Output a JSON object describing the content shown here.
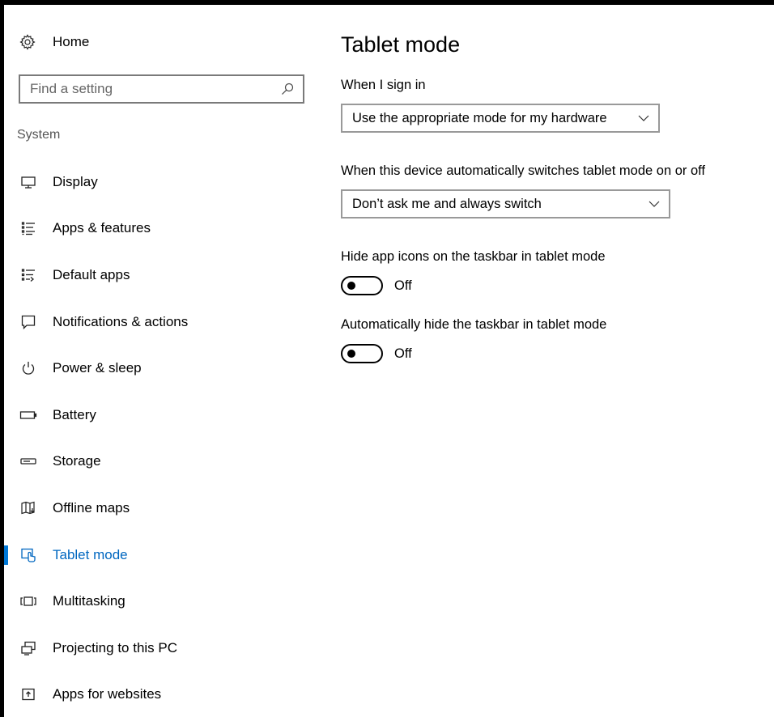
{
  "sidebar": {
    "home_label": "Home",
    "search_placeholder": "Find a setting",
    "section_title": "System",
    "items": [
      {
        "label": "Display",
        "icon": "display-icon"
      },
      {
        "label": "Apps & features",
        "icon": "apps-features-icon"
      },
      {
        "label": "Default apps",
        "icon": "default-apps-icon"
      },
      {
        "label": "Notifications & actions",
        "icon": "notifications-icon"
      },
      {
        "label": "Power & sleep",
        "icon": "power-icon"
      },
      {
        "label": "Battery",
        "icon": "battery-icon"
      },
      {
        "label": "Storage",
        "icon": "storage-icon"
      },
      {
        "label": "Offline maps",
        "icon": "map-icon"
      },
      {
        "label": "Tablet mode",
        "icon": "tablet-mode-icon",
        "active": true
      },
      {
        "label": "Multitasking",
        "icon": "multitasking-icon"
      },
      {
        "label": "Projecting to this PC",
        "icon": "projecting-icon"
      },
      {
        "label": "Apps for websites",
        "icon": "apps-websites-icon"
      }
    ]
  },
  "main": {
    "title": "Tablet mode",
    "sign_in": {
      "label": "When I sign in",
      "value": "Use the appropriate mode for my hardware"
    },
    "auto_switch": {
      "label": "When this device automatically switches tablet mode on or off",
      "value": "Don’t ask me and always switch"
    },
    "hide_icons": {
      "label": "Hide app icons on the taskbar in tablet mode",
      "state": "Off"
    },
    "hide_taskbar": {
      "label": "Automatically hide the taskbar in tablet mode",
      "state": "Off"
    }
  },
  "colors": {
    "accent": "#0078d7",
    "active_text": "#0067c0"
  }
}
